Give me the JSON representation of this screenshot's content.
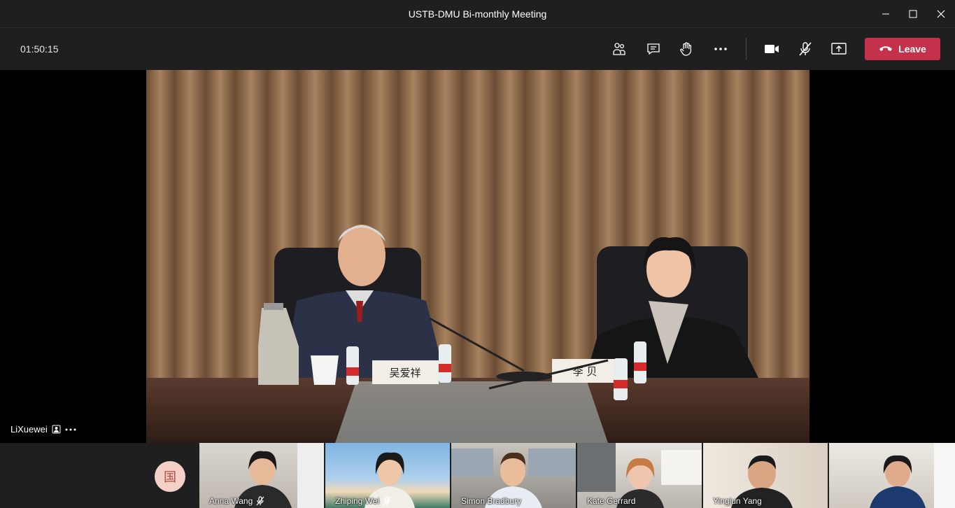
{
  "window": {
    "title": "USTB-DMU Bi-monthly Meeting",
    "controls": [
      "minimize-icon",
      "maximize-icon",
      "close-icon"
    ]
  },
  "toolbar": {
    "timer": "01:50:15",
    "buttons": [
      "participants-icon",
      "chat-icon",
      "raise-hand-icon",
      "more-icon",
      "camera-icon",
      "mic-muted-icon",
      "share-screen-icon"
    ],
    "leave_label": "Leave",
    "leave_color": "#c4314b"
  },
  "main_video": {
    "presenter_name": "LiXuewei",
    "name_cards": [
      "吴爱祥",
      "李 贝"
    ]
  },
  "thumbnails": {
    "avatar_initial": "国",
    "participants": [
      {
        "name": "Anna Wang",
        "muted": true
      },
      {
        "name": "Zhiping Wei",
        "muted": true
      },
      {
        "name": "Simon Bradbury",
        "muted": false
      },
      {
        "name": "Kate Gerrard",
        "muted": false
      },
      {
        "name": "Yingjun Yang",
        "muted": false
      },
      {
        "name": "",
        "muted": false
      }
    ]
  }
}
